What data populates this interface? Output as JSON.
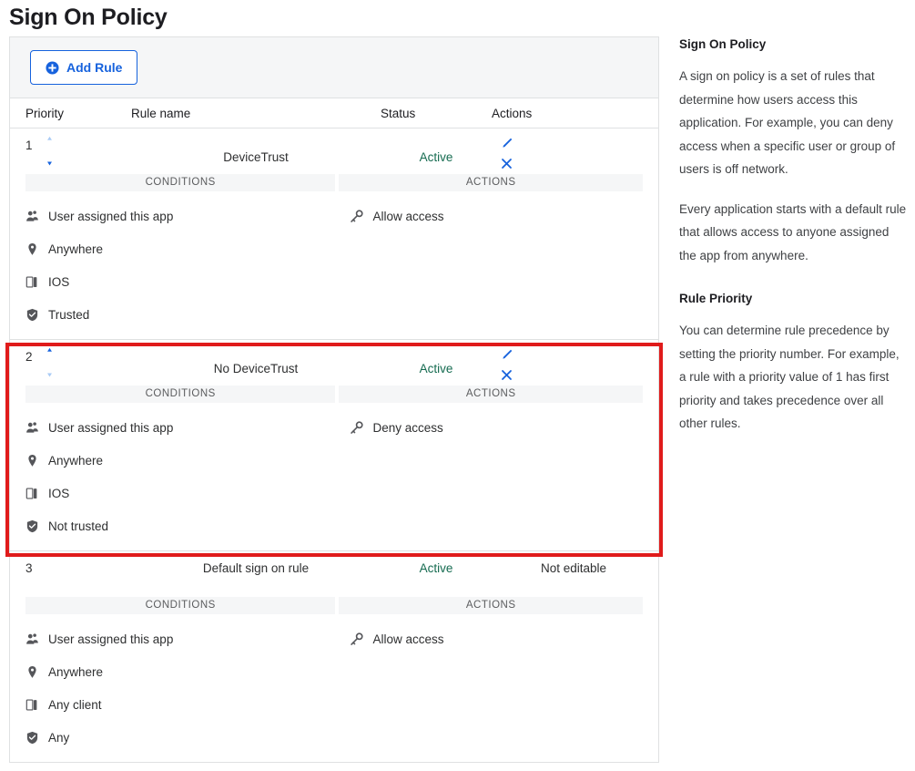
{
  "page_title": "Sign On Policy",
  "toolbar": {
    "add_rule_label": "Add Rule"
  },
  "table": {
    "columns": {
      "priority": "Priority",
      "rule_name": "Rule name",
      "status": "Status",
      "actions": "Actions"
    },
    "sub_headers": {
      "conditions": "CONDITIONS",
      "actions": "ACTIONS"
    },
    "not_editable_label": "Not editable",
    "rules": [
      {
        "priority": "1",
        "name": "DeviceTrust",
        "status": "Active",
        "up_enabled": false,
        "down_enabled": true,
        "editable": true,
        "conditions": [
          {
            "icon": "users-icon",
            "label": "User assigned this app"
          },
          {
            "icon": "location-pin-icon",
            "label": "Anywhere"
          },
          {
            "icon": "device-icon",
            "label": "IOS"
          },
          {
            "icon": "shield-check-icon",
            "label": "Trusted"
          }
        ],
        "actions": [
          {
            "icon": "key-icon",
            "label": "Allow access"
          }
        ]
      },
      {
        "priority": "2",
        "name": "No DeviceTrust",
        "status": "Active",
        "up_enabled": true,
        "down_enabled": false,
        "editable": true,
        "highlighted": true,
        "conditions": [
          {
            "icon": "users-icon",
            "label": "User assigned this app"
          },
          {
            "icon": "location-pin-icon",
            "label": "Anywhere"
          },
          {
            "icon": "device-icon",
            "label": "IOS"
          },
          {
            "icon": "shield-check-icon",
            "label": "Not trusted"
          }
        ],
        "actions": [
          {
            "icon": "key-icon",
            "label": "Deny access"
          }
        ]
      },
      {
        "priority": "3",
        "name": "Default sign on rule",
        "status": "Active",
        "up_enabled": false,
        "down_enabled": false,
        "editable": false,
        "conditions": [
          {
            "icon": "users-icon",
            "label": "User assigned this app"
          },
          {
            "icon": "location-pin-icon",
            "label": "Anywhere"
          },
          {
            "icon": "device-icon",
            "label": "Any client"
          },
          {
            "icon": "shield-check-icon",
            "label": "Any"
          }
        ],
        "actions": [
          {
            "icon": "key-icon",
            "label": "Allow access"
          }
        ]
      }
    ]
  },
  "info_panel": {
    "heading_1": "Sign On Policy",
    "paragraph_1": "A sign on policy is a set of rules that determine how users access this application. For example, you can deny access when a specific user or group of users is off network.",
    "paragraph_2": "Every application starts with a default rule that allows access to anyone assigned the app from anywhere.",
    "heading_2": "Rule Priority",
    "paragraph_3": "You can determine rule precedence by setting the priority number. For example, a rule with a priority value of 1 has first priority and takes precedence over all other rules."
  },
  "colors": {
    "accent_blue": "#1662dd",
    "arrow_disabled": "#a9cbf5",
    "status_green": "#156b50",
    "highlight_red": "#e01b1b",
    "icon_gray": "#55565a"
  }
}
